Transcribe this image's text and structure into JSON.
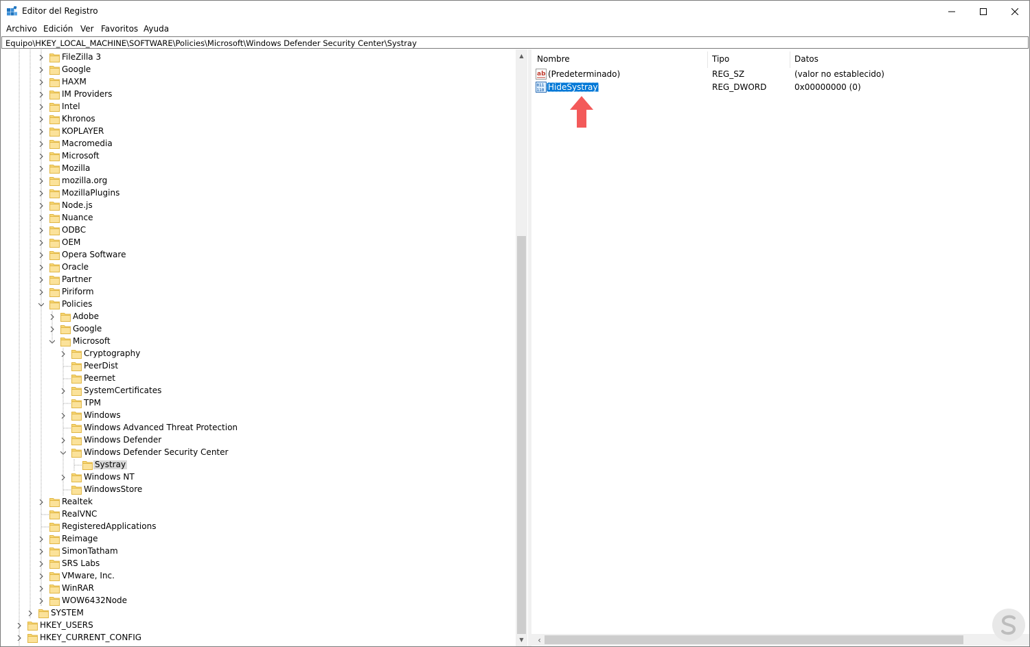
{
  "window": {
    "title": "Editor del Registro",
    "controls": {
      "minimize": "—",
      "maximize": "☐",
      "close": "✕"
    }
  },
  "menu": [
    "Archivo",
    "Edición",
    "Ver",
    "Favoritos",
    "Ayuda"
  ],
  "address": "Equipo\\HKEY_LOCAL_MACHINE\\SOFTWARE\\Policies\\Microsoft\\Windows Defender Security Center\\Systray",
  "tree": [
    {
      "label": "FileZilla 3",
      "depth": 3,
      "state": "collapsed"
    },
    {
      "label": "Google",
      "depth": 3,
      "state": "collapsed"
    },
    {
      "label": "HAXM",
      "depth": 3,
      "state": "collapsed"
    },
    {
      "label": "IM Providers",
      "depth": 3,
      "state": "collapsed"
    },
    {
      "label": "Intel",
      "depth": 3,
      "state": "collapsed"
    },
    {
      "label": "Khronos",
      "depth": 3,
      "state": "collapsed"
    },
    {
      "label": "KOPLAYER",
      "depth": 3,
      "state": "collapsed"
    },
    {
      "label": "Macromedia",
      "depth": 3,
      "state": "collapsed"
    },
    {
      "label": "Microsoft",
      "depth": 3,
      "state": "collapsed"
    },
    {
      "label": "Mozilla",
      "depth": 3,
      "state": "collapsed"
    },
    {
      "label": "mozilla.org",
      "depth": 3,
      "state": "collapsed"
    },
    {
      "label": "MozillaPlugins",
      "depth": 3,
      "state": "collapsed"
    },
    {
      "label": "Node.js",
      "depth": 3,
      "state": "collapsed"
    },
    {
      "label": "Nuance",
      "depth": 3,
      "state": "collapsed"
    },
    {
      "label": "ODBC",
      "depth": 3,
      "state": "collapsed"
    },
    {
      "label": "OEM",
      "depth": 3,
      "state": "collapsed"
    },
    {
      "label": "Opera Software",
      "depth": 3,
      "state": "collapsed"
    },
    {
      "label": "Oracle",
      "depth": 3,
      "state": "collapsed"
    },
    {
      "label": "Partner",
      "depth": 3,
      "state": "collapsed"
    },
    {
      "label": "Piriform",
      "depth": 3,
      "state": "collapsed"
    },
    {
      "label": "Policies",
      "depth": 3,
      "state": "expanded"
    },
    {
      "label": "Adobe",
      "depth": 4,
      "state": "collapsed"
    },
    {
      "label": "Google",
      "depth": 4,
      "state": "collapsed"
    },
    {
      "label": "Microsoft",
      "depth": 4,
      "state": "expanded"
    },
    {
      "label": "Cryptography",
      "depth": 5,
      "state": "collapsed"
    },
    {
      "label": "PeerDist",
      "depth": 5,
      "state": "leaf"
    },
    {
      "label": "Peernet",
      "depth": 5,
      "state": "leaf"
    },
    {
      "label": "SystemCertificates",
      "depth": 5,
      "state": "collapsed"
    },
    {
      "label": "TPM",
      "depth": 5,
      "state": "leaf"
    },
    {
      "label": "Windows",
      "depth": 5,
      "state": "collapsed"
    },
    {
      "label": "Windows Advanced Threat Protection",
      "depth": 5,
      "state": "leaf"
    },
    {
      "label": "Windows Defender",
      "depth": 5,
      "state": "collapsed"
    },
    {
      "label": "Windows Defender Security Center",
      "depth": 5,
      "state": "expanded"
    },
    {
      "label": "Systray",
      "depth": 6,
      "state": "leaf",
      "selected": true
    },
    {
      "label": "Windows NT",
      "depth": 5,
      "state": "collapsed"
    },
    {
      "label": "WindowsStore",
      "depth": 5,
      "state": "leaf"
    },
    {
      "label": "Realtek",
      "depth": 3,
      "state": "collapsed"
    },
    {
      "label": "RealVNC",
      "depth": 3,
      "state": "leaf"
    },
    {
      "label": "RegisteredApplications",
      "depth": 3,
      "state": "leaf"
    },
    {
      "label": "Reimage",
      "depth": 3,
      "state": "collapsed"
    },
    {
      "label": "SimonTatham",
      "depth": 3,
      "state": "collapsed"
    },
    {
      "label": "SRS Labs",
      "depth": 3,
      "state": "collapsed"
    },
    {
      "label": "VMware, Inc.",
      "depth": 3,
      "state": "collapsed"
    },
    {
      "label": "WinRAR",
      "depth": 3,
      "state": "collapsed"
    },
    {
      "label": "WOW6432Node",
      "depth": 3,
      "state": "collapsed"
    },
    {
      "label": "SYSTEM",
      "depth": 2,
      "state": "collapsed"
    },
    {
      "label": "HKEY_USERS",
      "depth": 1,
      "state": "collapsed"
    },
    {
      "label": "HKEY_CURRENT_CONFIG",
      "depth": 1,
      "state": "collapsed"
    }
  ],
  "values_pane": {
    "columns": [
      "Nombre",
      "Tipo",
      "Datos"
    ],
    "rows": [
      {
        "icon": "string-value-icon",
        "name": "(Predeterminado)",
        "type": "REG_SZ",
        "data": "(valor no establecido)",
        "selected": false
      },
      {
        "icon": "binary-value-icon",
        "name": "HideSystray",
        "type": "REG_DWORD",
        "data": "0x00000000 (0)",
        "selected": true
      }
    ]
  },
  "annotation": {
    "arrow_color": "#f35a5a"
  },
  "colors": {
    "selection": "#0078d7",
    "tree_selection": "#d9d9d9",
    "folder": "#f8d775",
    "folder_edge": "#e0b644"
  }
}
